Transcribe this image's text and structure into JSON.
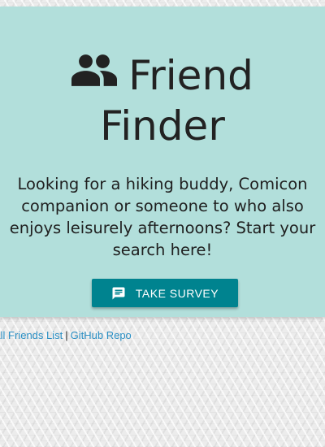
{
  "header": {
    "icon": "group-icon",
    "title_line1": "Friend",
    "title_line2": "Finder",
    "tagline": "Looking for a hiking buddy, Comicon companion or someone to who also enjoys leisurely afternoons? Start your search here!"
  },
  "survey_button": {
    "icon": "chat-icon",
    "label": "TAKE SURVEY"
  },
  "footer": {
    "friends_list_label": "All Friends List",
    "separator": "|",
    "github_label": "GitHub Repo"
  },
  "colors": {
    "jumbotron_bg": "#b2dfdb",
    "button_bg": "#00838f",
    "link": "#2a8fc4"
  }
}
